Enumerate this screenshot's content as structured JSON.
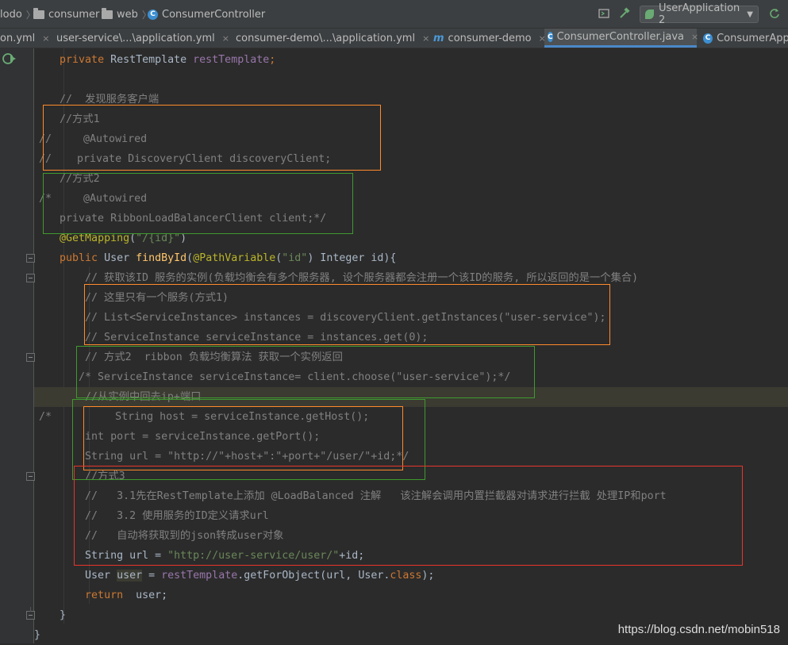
{
  "breadcrumb": [
    {
      "label": "lodo"
    },
    {
      "label": "consumer"
    },
    {
      "label": "web"
    },
    {
      "label": "ConsumerController"
    }
  ],
  "toolbar": {
    "run_config": "UserApplication 2"
  },
  "tabs": [
    {
      "label": "on.yml"
    },
    {
      "label": "user-service\\...\\application.yml"
    },
    {
      "label": "consumer-demo\\...\\application.yml"
    },
    {
      "label": "consumer-demo"
    },
    {
      "label": "ConsumerController.java",
      "active": true
    },
    {
      "label": "ConsumerAppli"
    }
  ],
  "code": {
    "l1": [
      "    ",
      "private",
      " RestTemplate ",
      "restTemplate",
      ";"
    ],
    "l3": "    //  发现服务客户端",
    "l4": "    //方式1",
    "l5": "//     @Autowired",
    "l6": "//    private DiscoveryClient discoveryClient;",
    "l7": "    //方式2",
    "l8": "/*     @Autowired",
    "l9": "    private RibbonLoadBalancerClient client;*/",
    "l10": [
      "    ",
      "@GetMapping",
      "(",
      "\"/{id}\"",
      ")"
    ],
    "l11": [
      "    ",
      "public",
      " User ",
      "findById",
      "(",
      "@PathVariable",
      "(",
      "\"id\"",
      ") Integer id){"
    ],
    "l12": "        // 获取该ID 服务的实例(负载均衡会有多个服务器, 设个服务器都会注册一个该ID的服务, 所以返回的是一个集合)",
    "l13": "        // 这里只有一个服务(方式1)",
    "l14": "        // List<ServiceInstance> instances = discoveryClient.getInstances(\"user-service\");",
    "l15": "        // ServiceInstance serviceInstance = instances.get(0);",
    "l16": "        // 方式2  ribbon 负载均衡算法 获取一个实例返回",
    "l17": "       /* ServiceInstance serviceInstance= client.choose(\"user-service\");*/",
    "l18": "        //从实例中回去ip+端口",
    "l19": "/*          String host = serviceInstance.getHost();",
    "l20": "        int port = serviceInstance.getPort();",
    "l21": "        String url = \"http://\"+host+\":\"+port+\"/user/\"+id;*/",
    "l22": "        //方式3",
    "l23": "        //   3.1先在RestTemplate上添加 @LoadBalanced 注解   该注解会调用内置拦截器对请求进行拦截 处理IP和port",
    "l24": "        //   3.2 使用服务的ID定义请求url",
    "l25": "        //   自动将获取到的json转成user对象",
    "l26": [
      "        String url = ",
      "\"http://user-service/user/\"",
      "+id;"
    ],
    "l27": [
      "        User ",
      "user",
      " = ",
      "restTemplate",
      ".getForObject(url, User.",
      "class",
      ");"
    ],
    "l28": [
      "        ",
      "return",
      "  user;"
    ],
    "l29": "    }",
    "l30": "}"
  },
  "watermark": "https://blog.csdn.net/mobin518",
  "colors": {
    "background": "#2b2b2b",
    "keyword": "#cc7832",
    "comment": "#808080",
    "string": "#6a8759",
    "annotation": "#bbb529",
    "field": "#9876aa",
    "box_orange": "#ff8a2b",
    "box_green": "#3f9a2e",
    "box_red": "#e8342c"
  }
}
